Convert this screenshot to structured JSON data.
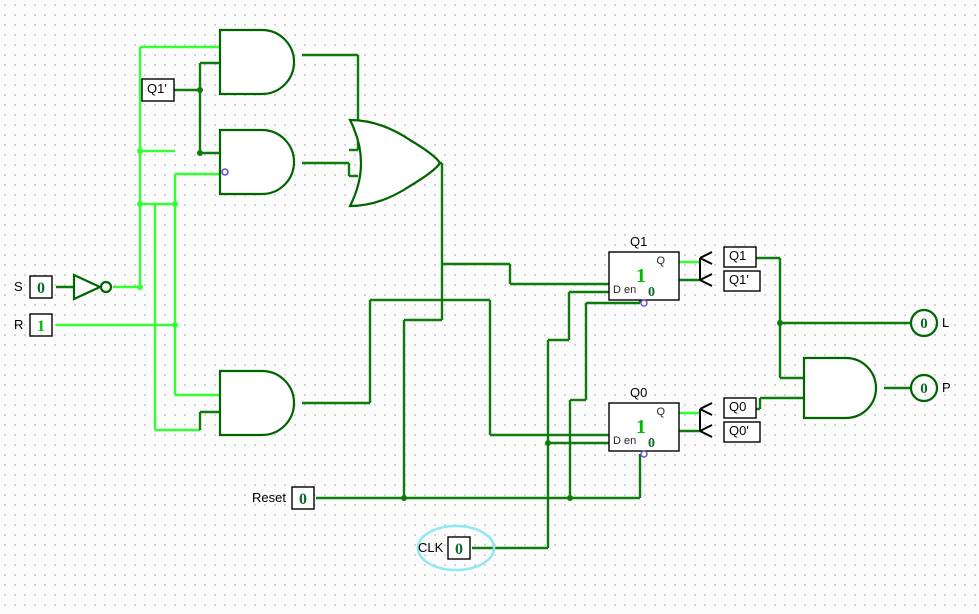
{
  "inputs": {
    "S": {
      "label": "S",
      "value": "0",
      "state": "lo"
    },
    "R": {
      "label": "R",
      "value": "1",
      "state": "hi"
    },
    "Reset": {
      "label": "Reset",
      "value": "0",
      "state": "lo"
    },
    "CLK": {
      "label": "CLK",
      "value": "0",
      "state": "lo"
    },
    "Q1p_tunnel_label": "Q1'"
  },
  "flipflops": {
    "Q1": {
      "title": "Q1",
      "D": "D",
      "en": "en",
      "Q": "Q",
      "state": "1",
      "enval": "0"
    },
    "Q0": {
      "title": "Q0",
      "D": "D",
      "en": "en",
      "Q": "Q",
      "state": "1",
      "enval": "0"
    }
  },
  "tunnels": {
    "Q1": "Q1",
    "Q1p": "Q1'",
    "Q0": "Q0",
    "Q0p": "Q0'"
  },
  "outputs": {
    "L": {
      "label": "L",
      "value": "0"
    },
    "P": {
      "label": "P",
      "value": "0"
    }
  }
}
